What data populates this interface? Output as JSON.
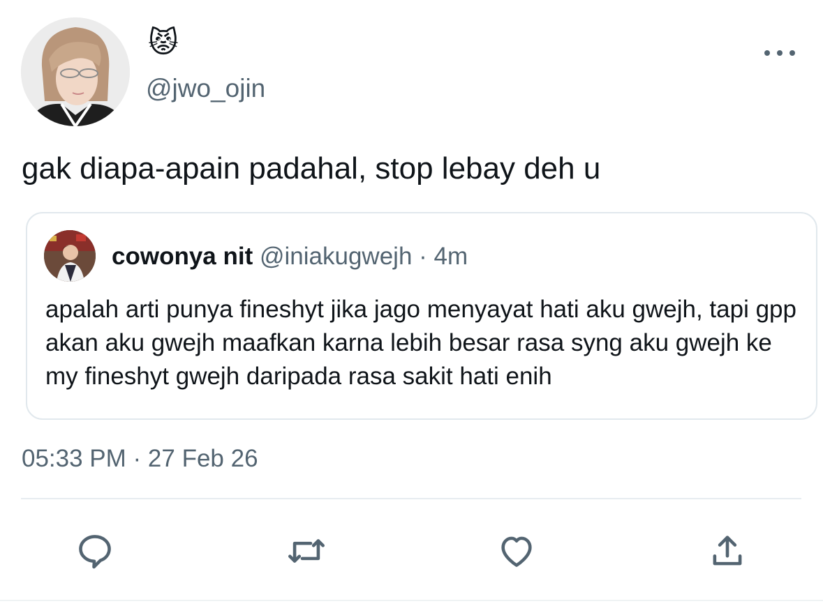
{
  "tweet": {
    "display_name_emoji": "😾",
    "handle": "@jwo_ojin",
    "text": "gak diapa-apain padahal, stop lebay deh u",
    "timestamp": "05:33 PM · 27 Feb 26"
  },
  "quote": {
    "name": "cowonya nit",
    "handle": "@iniakugwejh",
    "separator": " · ",
    "age": "4m",
    "text": "apalah arti punya fineshyt jika jago menyayat hati aku gwejh, tapi gpp akan aku gwejh maafkan karna lebih besar rasa syng aku gwejh ke my fineshyt gwejh daripada rasa sakit hati enih"
  },
  "actions": [
    {
      "icon": "reply-icon"
    },
    {
      "icon": "retweet-icon"
    },
    {
      "icon": "like-icon"
    },
    {
      "icon": "share-icon"
    }
  ],
  "colors": {
    "text_primary": "#0f1419",
    "text_secondary": "#536471",
    "border": "#e1e8ed"
  }
}
